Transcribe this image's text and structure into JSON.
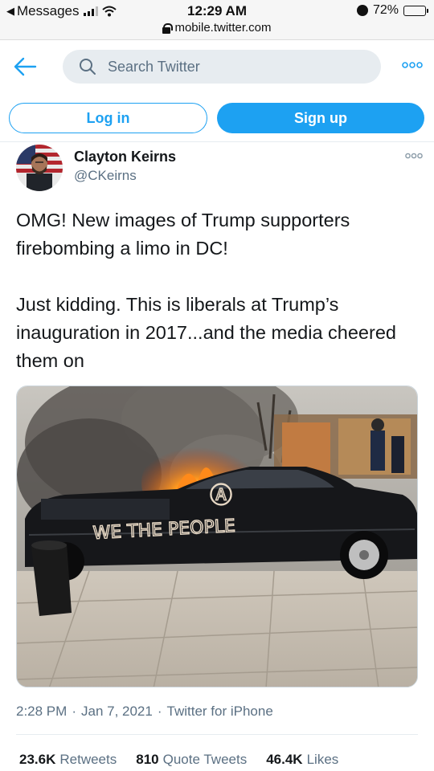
{
  "status_bar": {
    "back_app": "Messages",
    "time": "12:29 AM",
    "url": "mobile.twitter.com",
    "battery": "72%",
    "battery_level": 0.72
  },
  "header": {
    "search_placeholder": "Search Twitter",
    "icons": {
      "back": "back-arrow-icon",
      "search": "search-icon",
      "more": "more-icon"
    }
  },
  "auth": {
    "login_label": "Log in",
    "signup_label": "Sign up"
  },
  "tweet": {
    "author_name": "Clayton Keirns",
    "author_handle": "@CKeirns",
    "text_line1": "OMG! New images of Trump supporters firebombing a limo in DC!",
    "text_line2": "Just kidding. This is liberals at Trump’s inauguration in 2017...and the media cheered them on",
    "graffiti": "WE THE PEOPLE",
    "time": "2:28 PM",
    "date": "Jan 7, 2021",
    "source": "Twitter for iPhone",
    "separator": "·",
    "retweets_count": "23.6K",
    "retweets_label": "Retweets",
    "quote_count": "810",
    "quote_label": "Quote Tweets",
    "likes_count": "46.4K",
    "likes_label": "Likes"
  },
  "colors": {
    "accent": "#1da1f2",
    "text_primary": "#14171a",
    "text_secondary": "#5b7083",
    "search_bg": "#e7ecf0"
  }
}
